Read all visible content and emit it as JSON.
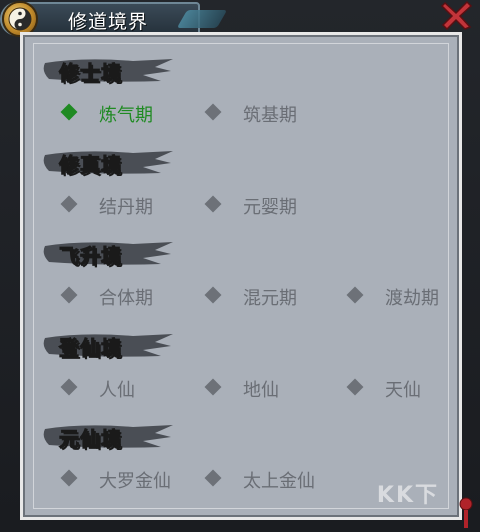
{
  "window": {
    "title": "修道境界",
    "close_icon": "close-x-icon",
    "emblem_icon": "taiji-emblem-icon"
  },
  "realms": [
    {
      "title": "修士境",
      "color": "#3fc6ff",
      "stages": [
        {
          "label": "炼气期",
          "active": true
        },
        {
          "label": "筑基期",
          "active": false
        }
      ]
    },
    {
      "title": "修真境",
      "color": "#d85cff",
      "stages": [
        {
          "label": "结丹期",
          "active": false
        },
        {
          "label": "元婴期",
          "active": false
        }
      ]
    },
    {
      "title": "飞升境",
      "color": "#ffb13a",
      "stages": [
        {
          "label": "合体期",
          "active": false
        },
        {
          "label": "混元期",
          "active": false
        },
        {
          "label": "渡劫期",
          "active": false
        }
      ]
    },
    {
      "title": "登仙境",
      "color": "#ff4a3a",
      "stages": [
        {
          "label": "人仙",
          "active": false
        },
        {
          "label": "地仙",
          "active": false
        },
        {
          "label": "天仙",
          "active": false
        }
      ]
    },
    {
      "title": "元仙境",
      "color": "#ffe14a",
      "stages": [
        {
          "label": "大罗金仙",
          "active": false
        },
        {
          "label": "太上金仙",
          "active": false
        }
      ]
    }
  ],
  "watermark": "KK下"
}
